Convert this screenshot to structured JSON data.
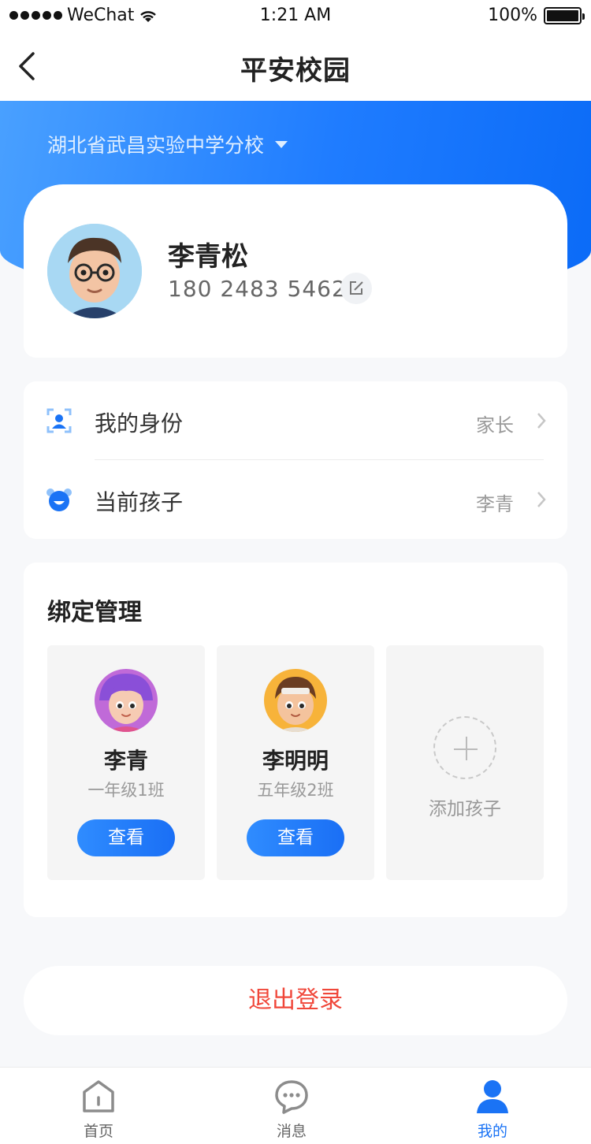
{
  "status_bar": {
    "carrier": "WeChat",
    "time": "1:21 AM",
    "battery": "100%"
  },
  "nav": {
    "title": "平安校园"
  },
  "school": {
    "name": "湖北省武昌实验中学分校"
  },
  "profile": {
    "name": "李青松",
    "phone": "180 2483 5462"
  },
  "info": {
    "identity_label": "我的身份",
    "identity_value": "家长",
    "child_label": "当前孩子",
    "child_value": "李青"
  },
  "bind": {
    "title": "绑定管理",
    "children": [
      {
        "name": "李青",
        "class": "一年级1班",
        "button": "查看"
      },
      {
        "name": "李明明",
        "class": "五年级2班",
        "button": "查看"
      }
    ],
    "add_label": "添加孩子"
  },
  "logout": {
    "label": "退出登录"
  },
  "tabs": [
    {
      "label": "首页",
      "icon": "home-icon",
      "active": false
    },
    {
      "label": "消息",
      "icon": "message-icon",
      "active": false
    },
    {
      "label": "我的",
      "icon": "person-icon",
      "active": true
    }
  ],
  "colors": {
    "accent": "#1a73f5",
    "danger": "#f0473a"
  }
}
